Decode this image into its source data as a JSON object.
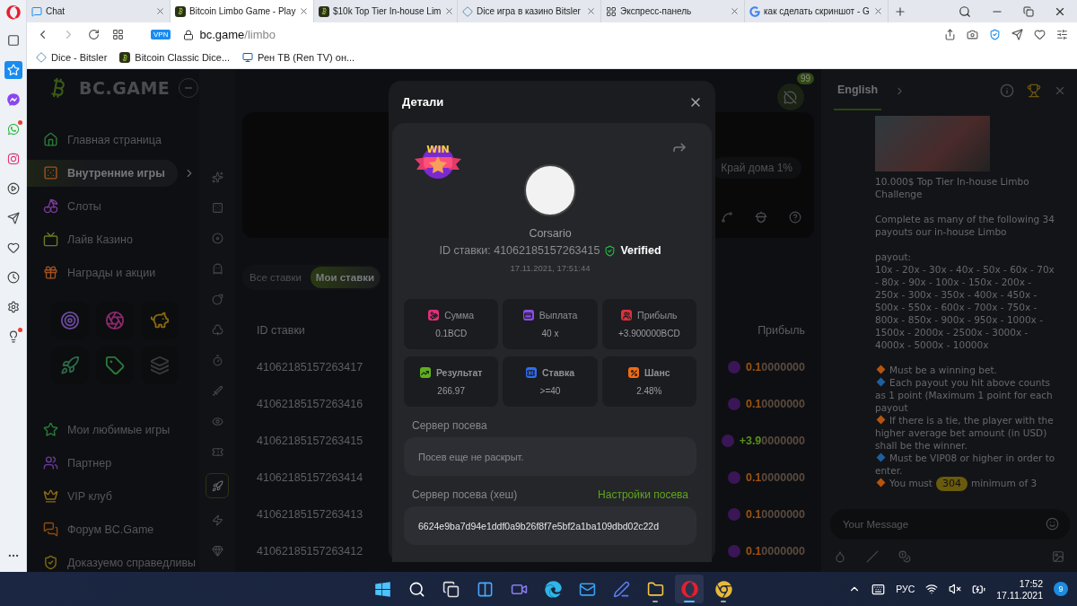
{
  "opera_sidebar": [
    {
      "selected": false,
      "dot": false
    },
    {
      "selected": true,
      "dot": false
    },
    {
      "selected": false,
      "dot": false
    },
    {
      "selected": false,
      "dot": true
    },
    {
      "selected": false,
      "dot": false
    },
    {
      "selected": false,
      "dot": false
    },
    {
      "selected": false,
      "dot": false
    },
    {
      "selected": false,
      "dot": false
    },
    {
      "selected": false,
      "dot": false
    },
    {
      "selected": false,
      "dot": false
    },
    {
      "selected": false,
      "dot": true
    },
    {
      "selected": false,
      "dot": false
    }
  ],
  "browser": {
    "tabs": [
      {
        "title": "Chat",
        "selected": false
      },
      {
        "title": "Bitcoin Limbo Game - Play",
        "selected": true
      },
      {
        "title": "$10k Top Tier In-house Lim",
        "selected": false
      },
      {
        "title": "Dice игра в казино Bitsler",
        "selected": false
      },
      {
        "title": "Экспресс-панель",
        "selected": false
      },
      {
        "title": "как сделать скриншот - G",
        "selected": false
      }
    ],
    "vpn": "VPN",
    "address": {
      "host": "bc.game",
      "path": "/limbo"
    },
    "bookmarks": [
      "Dice - Bitsler",
      "Bitcoin Classic Dice...",
      "Рен ТВ (Ren TV) он..."
    ]
  },
  "nav": {
    "logo": "BC.GAME",
    "items": [
      {
        "label": "Главная страница",
        "selected": false
      },
      {
        "label": "Внутренние игры",
        "selected": true
      },
      {
        "label": "Слоты",
        "selected": false
      },
      {
        "label": "Лайв Казино",
        "selected": false
      },
      {
        "label": "Награды и акции",
        "selected": false
      }
    ],
    "bottom_items": [
      {
        "label": "Мои любимые игры",
        "selected": false
      },
      {
        "label": "Партнер",
        "selected": false
      },
      {
        "label": "VIP клуб",
        "selected": false
      },
      {
        "label": "Форум BC.Game",
        "selected": false
      },
      {
        "label": "Доказуемо справедливы",
        "selected": false
      }
    ]
  },
  "game_strip": [
    {
      "selected": false
    },
    {
      "selected": false
    },
    {
      "selected": false
    },
    {
      "selected": false
    },
    {
      "selected": false
    },
    {
      "selected": false
    },
    {
      "selected": false
    },
    {
      "selected": false
    },
    {
      "selected": false
    },
    {
      "selected": false
    },
    {
      "selected": true
    },
    {
      "selected": false
    },
    {
      "selected": false
    }
  ],
  "main": {
    "unread": "99",
    "house_edge": "Край дома 1%",
    "bet_tabs": [
      {
        "label": "Все ставки",
        "selected": false
      },
      {
        "label": "Мои ставки",
        "selected": true
      }
    ],
    "columns": [
      "ID ставки",
      "Прибыль"
    ],
    "rows": [
      {
        "id": "41062185157263417",
        "profit_lead": "0.1",
        "profit_tail": "0000000",
        "win": false
      },
      {
        "id": "41062185157263416",
        "profit_lead": "0.1",
        "profit_tail": "0000000",
        "win": false
      },
      {
        "id": "41062185157263415",
        "profit_lead": "+3.9",
        "profit_tail": "0000000",
        "win": true
      },
      {
        "id": "41062185157263414",
        "profit_lead": "0.1",
        "profit_tail": "0000000",
        "win": false
      },
      {
        "id": "41062185157263413",
        "profit_lead": "0.1",
        "profit_tail": "0000000",
        "win": false
      },
      {
        "id": "41062185157263412",
        "profit_lead": "0.1",
        "profit_tail": "0000000",
        "win": false
      }
    ]
  },
  "chat": {
    "language": "English",
    "message": {
      "title": "10.000$ Top Tier In-house Limbo Challenge",
      "intro": "Complete as many of the following 34 payouts our in-house Limbo",
      "payout_label": "payout:",
      "payouts": "10x - 20x - 30x - 40x - 50x - 60x - 70x - 80x - 90x - 100x - 150x - 200x - 250x - 300x - 350x - 400x - 450x - 500x - 550x - 600x - 700x - 750x - 800x - 850x - 900x - 950x - 1000x - 1500x - 2000x - 2500x - 3000x - 4000x - 5000x - 10000x",
      "rules": [
        {
          "text": "Must be a winning bet.",
          "color": "#b5540f"
        },
        {
          "text": "Each payout you hit above counts as 1 point (Maximum 1 point for each payout",
          "color": "#1f5f9e"
        },
        {
          "text": "If there is a tie, the player with the higher average bet amount (in USD) shall be the winner.",
          "color": "#b5540f"
        },
        {
          "text": "Must be VIP08 or higher in order to enter.",
          "color": "#1f5f9e"
        },
        {
          "text": "You must",
          "text_after": "minimum of 3",
          "color": "#b5540f"
        }
      ]
    },
    "new_messages": "304",
    "placeholder": "Your Message"
  },
  "modal": {
    "title": "Детали",
    "win": "WIN",
    "player": "Corsario",
    "bet_id": "ID ставки: 41062185157263415",
    "verified": "Verified",
    "time": "17.11.2021, 17:51:44",
    "stats": [
      {
        "label": "Сумма",
        "value": "0.1BCD",
        "color": "#e0307a"
      },
      {
        "label": "Выплата",
        "value": "40 x",
        "color": "#8a4dea"
      },
      {
        "label": "Прибыль",
        "value": "+3.900000BCD",
        "color": "#e0313a"
      },
      {
        "label": "Результат",
        "value": "266.97",
        "color": "#5fae1f"
      },
      {
        "label": "Ставка",
        "value": ">=40",
        "color": "#2f6cf0"
      },
      {
        "label": "Шанс",
        "value": "2.48%",
        "color": "#ef6c12"
      }
    ],
    "seed_label": "Сервер посева",
    "seed_value": "Посев еще не раскрыт.",
    "hash_label": "Сервер посева (хеш)",
    "seed_settings": "Настройки посева",
    "hash": "6624e9ba7d94e1ddf0a9b26f8f7e5bf2a1ba109dbd02c22d"
  },
  "taskbar": {
    "apps": [
      {
        "running": false,
        "selected": false
      },
      {
        "running": false,
        "selected": false
      },
      {
        "running": false,
        "selected": false
      },
      {
        "running": false,
        "selected": false
      },
      {
        "running": false,
        "selected": false
      },
      {
        "running": false,
        "selected": false
      },
      {
        "running": false,
        "selected": false
      },
      {
        "running": false,
        "selected": false
      },
      {
        "running": true,
        "selected": false
      },
      {
        "running": true,
        "selected": true
      },
      {
        "running": true,
        "selected": false
      }
    ],
    "lang": "РУС",
    "time": "17:52",
    "date": "17.11.2021",
    "notifications": "9"
  }
}
